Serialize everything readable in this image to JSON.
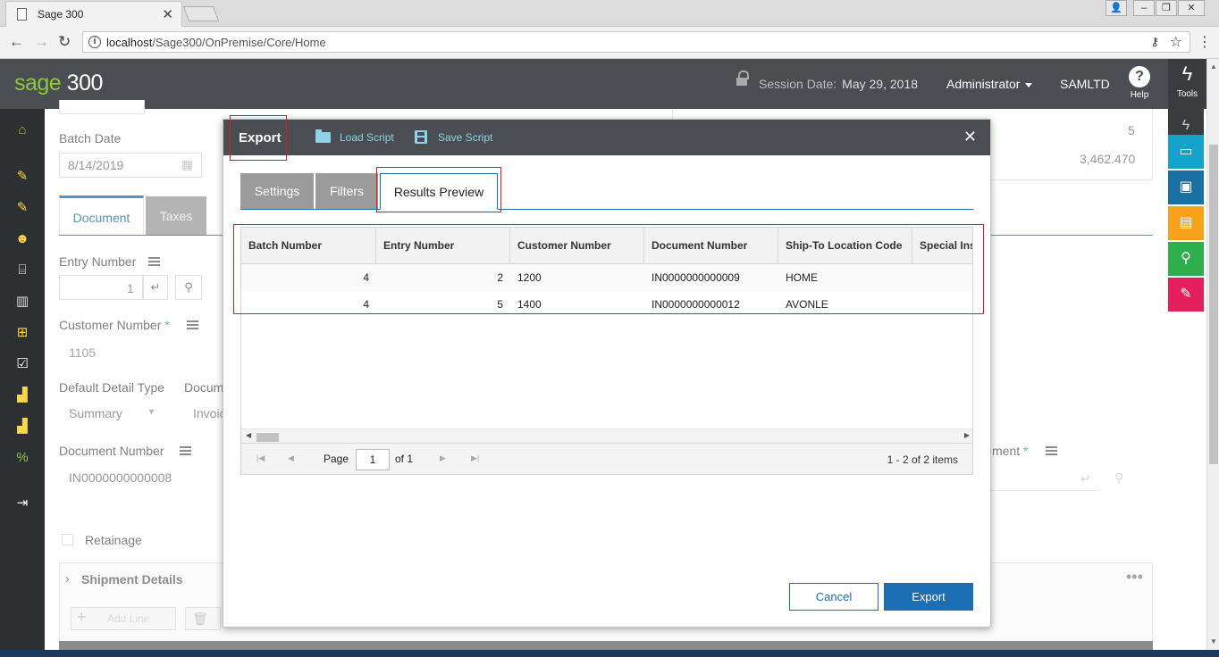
{
  "browser": {
    "tab_title": "Sage 300",
    "url_host": "localhost",
    "url_path": "/Sage300/OnPremise/Core/Home"
  },
  "header": {
    "logo_word": "sage",
    "logo_number": "300",
    "session_label": "Session Date:",
    "session_date": "May 29, 2018",
    "user": "Administrator",
    "company": "SAMLTD",
    "help_label": "Help",
    "tools_label": "Tools"
  },
  "background": {
    "batch_date_label": "Batch Date",
    "batch_date_value": "8/14/2019",
    "tab_document": "Document",
    "tab_taxes": "Taxes",
    "entry_number_label": "Entry Number",
    "entry_number_value": "1",
    "customer_number_label": "Customer Number",
    "customer_number_value": "1105",
    "default_detail_type_label": "Default Detail Type",
    "default_detail_type_value": "Summary",
    "document_type_label": "Docum",
    "document_type_value": "Invoic",
    "document_number_label": "Document Number",
    "document_number_value": "IN0000000000008",
    "retainage_label": "Retainage",
    "shipment_details_label": "Shipment Details",
    "add_line_label": "Add Line",
    "right_value_1": "5",
    "right_value_2": "3,462.470",
    "right_field_label": "ment",
    "required_mark": "*"
  },
  "modal": {
    "title": "Export",
    "load_script": "Load Script",
    "save_script": "Save Script",
    "close_glyph": "✕",
    "tabs": [
      {
        "label": "Settings"
      },
      {
        "label": "Filters"
      },
      {
        "label": "Results Preview"
      }
    ],
    "grid": {
      "columns": [
        "Batch Number",
        "Entry Number",
        "Customer Number",
        "Document Number",
        "Ship-To Location Code",
        "Special Ins"
      ],
      "rows": [
        [
          "4",
          "2",
          "1200",
          "IN0000000000009",
          "HOME",
          ""
        ],
        [
          "4",
          "5",
          "1400",
          "IN0000000000012",
          "AVONLE",
          ""
        ]
      ]
    },
    "pager": {
      "page_label": "Page",
      "page_value": "1",
      "of_label": "of 1",
      "count_label": "1 - 2 of 2 items"
    },
    "cancel_label": "Cancel",
    "export_label": "Export"
  },
  "colors": {
    "header_bg": "#4a4d52",
    "accent_blue": "#1c6fb5",
    "logo_green": "#8dc63f",
    "highlight_red": "#d61f1f"
  }
}
